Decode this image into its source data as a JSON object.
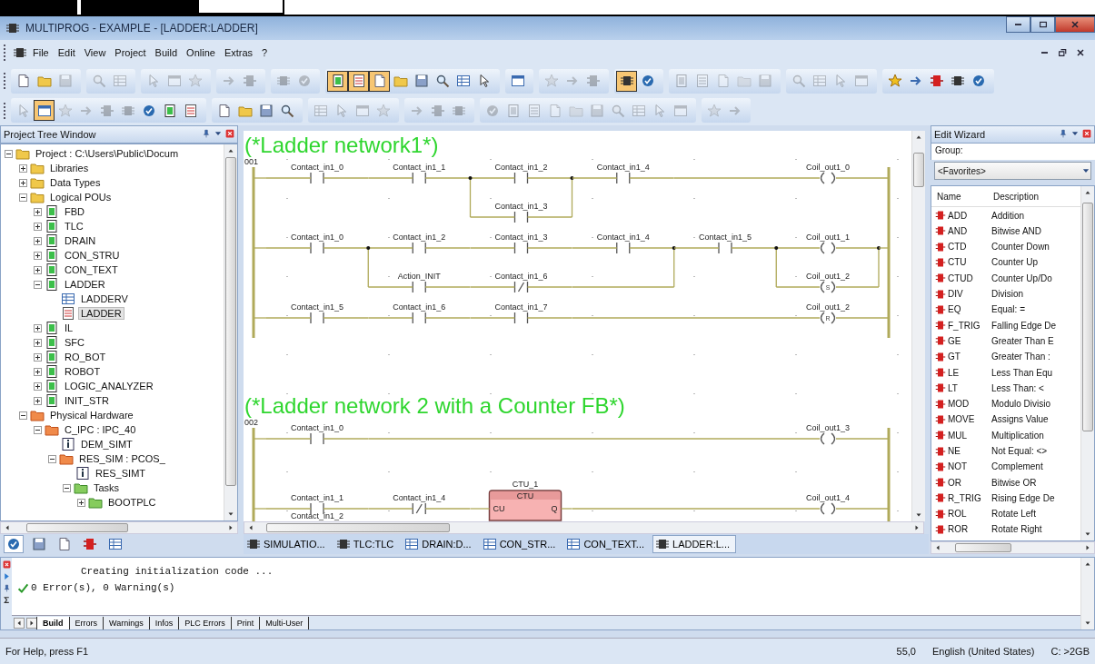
{
  "window": {
    "title": "MULTIPROG - EXAMPLE - [LADDER:LADDER]"
  },
  "menu": [
    "File",
    "Edit",
    "View",
    "Project",
    "Build",
    "Online",
    "Extras",
    "?"
  ],
  "toolbars": [
    [
      [
        {
          "on": false,
          "disabled": false
        },
        {
          "on": false,
          "disabled": false
        },
        {
          "on": false,
          "disabled": true
        }
      ],
      [
        {
          "on": false,
          "disabled": true
        },
        {
          "on": false,
          "disabled": true
        }
      ],
      [
        {
          "on": false,
          "disabled": true
        },
        {
          "on": false,
          "disabled": true
        },
        {
          "on": false,
          "disabled": true
        }
      ],
      [
        {
          "on": false,
          "disabled": true
        },
        {
          "on": false,
          "disabled": true
        }
      ],
      [
        {
          "on": false,
          "disabled": true
        },
        {
          "on": false,
          "disabled": true
        }
      ],
      [
        {
          "on": true,
          "disabled": false
        },
        {
          "on": true,
          "disabled": false
        },
        {
          "on": true,
          "disabled": false
        },
        {
          "on": false,
          "disabled": false
        },
        {
          "on": false,
          "disabled": false
        },
        {
          "on": false,
          "disabled": false
        },
        {
          "on": false,
          "disabled": false
        },
        {
          "on": false,
          "disabled": false
        }
      ],
      [
        {
          "on": false,
          "disabled": false
        }
      ],
      [
        {
          "on": false,
          "disabled": true
        },
        {
          "on": false,
          "disabled": true
        },
        {
          "on": false,
          "disabled": true
        }
      ],
      [
        {
          "on": true,
          "disabled": false
        },
        {
          "on": false,
          "disabled": false
        }
      ],
      [
        {
          "on": false,
          "disabled": true
        },
        {
          "on": false,
          "disabled": true
        },
        {
          "on": false,
          "disabled": true
        },
        {
          "on": false,
          "disabled": true
        },
        {
          "on": false,
          "disabled": true
        }
      ],
      [
        {
          "on": false,
          "disabled": true
        },
        {
          "on": false,
          "disabled": true
        },
        {
          "on": false,
          "disabled": true
        },
        {
          "on": false,
          "disabled": true
        }
      ],
      [
        {
          "on": false,
          "disabled": false
        },
        {
          "on": false,
          "disabled": false
        },
        {
          "on": false,
          "disabled": false
        },
        {
          "on": false,
          "disabled": false
        },
        {
          "on": false,
          "disabled": false
        }
      ]
    ],
    [
      [
        {
          "on": false,
          "disabled": true
        },
        {
          "on": true,
          "disabled": false
        },
        {
          "on": false,
          "disabled": true
        },
        {
          "on": false,
          "disabled": true
        },
        {
          "on": false,
          "disabled": true
        },
        {
          "on": false,
          "disabled": true
        },
        {
          "on": false,
          "disabled": false
        },
        {
          "on": false,
          "disabled": false
        },
        {
          "on": false,
          "disabled": false
        }
      ],
      [
        {
          "on": false,
          "disabled": false
        },
        {
          "on": false,
          "disabled": false
        },
        {
          "on": false,
          "disabled": false
        },
        {
          "on": false,
          "disabled": false
        }
      ],
      [
        {
          "on": false,
          "disabled": true
        },
        {
          "on": false,
          "disabled": true
        },
        {
          "on": false,
          "disabled": true
        },
        {
          "on": false,
          "disabled": true
        }
      ],
      [
        {
          "on": false,
          "disabled": true
        },
        {
          "on": false,
          "disabled": true
        },
        {
          "on": false,
          "disabled": true
        }
      ],
      [
        {
          "on": false,
          "disabled": true
        },
        {
          "on": false,
          "disabled": true
        },
        {
          "on": false,
          "disabled": true
        },
        {
          "on": false,
          "disabled": true
        },
        {
          "on": false,
          "disabled": true
        },
        {
          "on": false,
          "disabled": true
        },
        {
          "on": false,
          "disabled": true
        },
        {
          "on": false,
          "disabled": true
        },
        {
          "on": false,
          "disabled": true
        },
        {
          "on": false,
          "disabled": true
        }
      ],
      [
        {
          "on": false,
          "disabled": true
        },
        {
          "on": false,
          "disabled": true
        }
      ]
    ]
  ],
  "project_tree": {
    "title": "Project Tree Window",
    "items": [
      {
        "label": "Project : C:\\Users\\Public\\Docum",
        "kind": "folder",
        "expanded": true,
        "selected": false,
        "children": [
          {
            "label": "Libraries",
            "kind": "folder",
            "expanded": false,
            "selected": false
          },
          {
            "label": "Data Types",
            "kind": "folder",
            "expanded": false,
            "selected": false
          },
          {
            "label": "Logical POUs",
            "kind": "folder",
            "expanded": true,
            "selected": false,
            "children": [
              {
                "label": "FBD",
                "kind": "pou",
                "expanded": false,
                "selected": false
              },
              {
                "label": "TLC",
                "kind": "pou",
                "expanded": false,
                "selected": false
              },
              {
                "label": "DRAIN",
                "kind": "pou",
                "expanded": false,
                "selected": false
              },
              {
                "label": "CON_STRU",
                "kind": "pou",
                "expanded": false,
                "selected": false
              },
              {
                "label": "CON_TEXT",
                "kind": "pou",
                "expanded": false,
                "selected": false
              },
              {
                "label": "LADDER",
                "kind": "pou",
                "expanded": true,
                "selected": false,
                "children": [
                  {
                    "label": "LADDERV",
                    "kind": "vars",
                    "selected": false
                  },
                  {
                    "label": "LADDER",
                    "kind": "code",
                    "selected": true
                  }
                ]
              },
              {
                "label": "IL",
                "kind": "pou",
                "expanded": false,
                "selected": false
              },
              {
                "label": "SFC",
                "kind": "pou",
                "expanded": false,
                "selected": false
              },
              {
                "label": "RO_BOT",
                "kind": "pou",
                "expanded": false,
                "selected": false
              },
              {
                "label": "ROBOT",
                "kind": "pou",
                "expanded": false,
                "selected": false
              },
              {
                "label": "LOGIC_ANALYZER",
                "kind": "pou",
                "expanded": false,
                "selected": false
              },
              {
                "label": "INIT_STR",
                "kind": "pou",
                "expanded": false,
                "selected": false
              }
            ]
          },
          {
            "label": "Physical Hardware",
            "kind": "hw",
            "expanded": true,
            "selected": false,
            "children": [
              {
                "label": "C_IPC : IPC_40",
                "kind": "hw",
                "expanded": true,
                "selected": false,
                "children": [
                  {
                    "label": "DEM_SIMT",
                    "kind": "info",
                    "selected": false
                  },
                  {
                    "label": "RES_SIM : PCOS_",
                    "kind": "hw",
                    "expanded": true,
                    "selected": false,
                    "children": [
                      {
                        "label": "RES_SIMT",
                        "kind": "info",
                        "selected": false
                      },
                      {
                        "label": "Tasks",
                        "kind": "task",
                        "expanded": true,
                        "selected": false,
                        "children": [
                          {
                            "label": "BOOTPLC",
                            "kind": "task",
                            "expanded": false,
                            "selected": false
                          }
                        ]
                      }
                    ]
                  }
                ]
              }
            ]
          }
        ]
      }
    ],
    "tabs": [
      {
        "selected": true
      },
      {
        "selected": false
      },
      {
        "selected": false
      },
      {
        "selected": false
      },
      {
        "selected": false
      }
    ]
  },
  "editor": {
    "networks": [
      {
        "comment": "(*Ladder network1*)",
        "number": "001",
        "rungs": [
          {
            "items": [
              {
                "kind": "contact",
                "label": "Contact_in1_0"
              },
              {
                "kind": "contact",
                "label": "Contact_in1_1"
              },
              {
                "kind": "parallel",
                "branches": [
                  [
                    {
                      "kind": "contact",
                      "label": "Contact_in1_2"
                    }
                  ],
                  [
                    {
                      "kind": "contact",
                      "label": "Contact_in1_3"
                    }
                  ]
                ]
              },
              {
                "kind": "contact",
                "label": "Contact_in1_4"
              },
              {
                "kind": "coil",
                "label": "Coil_out1_0"
              }
            ]
          },
          {
            "items": [
              {
                "kind": "contact",
                "label": "Contact_in1_0"
              },
              {
                "kind": "parallel",
                "branches": [
                  [
                    {
                      "kind": "contact",
                      "label": "Contact_in1_2"
                    },
                    {
                      "kind": "contact",
                      "label": "Contact_in1_3"
                    },
                    {
                      "kind": "contact",
                      "label": "Contact_in1_4"
                    }
                  ],
                  [
                    {
                      "kind": "contact",
                      "label": "Action_INIT"
                    },
                    {
                      "kind": "contact_negated",
                      "label": "Contact_in1_6"
                    }
                  ]
                ]
              },
              {
                "kind": "contact",
                "label": "Contact_in1_5"
              },
              {
                "kind": "parallel",
                "branches": [
                  [
                    {
                      "kind": "coil",
                      "label": "Coil_out1_1"
                    }
                  ],
                  [
                    {
                      "kind": "coil",
                      "label": "Coil_out1_2",
                      "symbol": "S"
                    }
                  ]
                ]
              }
            ]
          },
          {
            "items": [
              {
                "kind": "contact",
                "label": "Contact_in1_5"
              },
              {
                "kind": "contact",
                "label": "Contact_in1_6"
              },
              {
                "kind": "contact",
                "label": "Contact_in1_7"
              },
              {
                "kind": "coil",
                "label": "Coil_out1_2",
                "symbol": "R"
              }
            ]
          }
        ]
      },
      {
        "comment": "(*Ladder network 2 with a Counter FB*)",
        "number": "002",
        "rungs": [
          {
            "items": [
              {
                "kind": "contact",
                "label": "Contact_in1_0"
              },
              {
                "kind": "coil",
                "label": "Coil_out1_3"
              }
            ]
          },
          {
            "items": [
              {
                "kind": "parallel",
                "branches": [
                  [
                    {
                      "kind": "contact",
                      "label": "Contact_in1_1"
                    }
                  ],
                  [
                    {
                      "kind": "contact",
                      "label": "Contact_in1_2",
                      "clipped": true
                    }
                  ]
                ]
              },
              {
                "kind": "contact_negated",
                "label": "Contact_in1_4"
              },
              {
                "kind": "fb",
                "instance": "CTU_1",
                "type": "CTU",
                "inputs": [
                  "CU"
                ],
                "outputs": [
                  "Q"
                ]
              },
              {
                "kind": "coil",
                "label": "Coil_out1_4"
              }
            ]
          }
        ]
      }
    ],
    "tabs": [
      {
        "label": "SIMULATIO...",
        "kind": "ladder",
        "selected": false
      },
      {
        "label": "TLC:TLC",
        "kind": "ladder",
        "selected": false
      },
      {
        "label": "DRAIN:D...",
        "kind": "table",
        "selected": false
      },
      {
        "label": "CON_STR...",
        "kind": "table",
        "selected": false
      },
      {
        "label": "CON_TEXT...",
        "kind": "table",
        "selected": false
      },
      {
        "label": "LADDER:L...",
        "kind": "ladder",
        "selected": true
      }
    ]
  },
  "edit_wizard": {
    "title": "Edit Wizard",
    "group_label": "Group:",
    "group_value": "<Favorites>",
    "columns": [
      "Name",
      "Description"
    ],
    "rows": [
      {
        "name": "ADD",
        "description": "Addition"
      },
      {
        "name": "AND",
        "description": "Bitwise AND"
      },
      {
        "name": "CTD",
        "description": "Counter Down"
      },
      {
        "name": "CTU",
        "description": "Counter Up"
      },
      {
        "name": "CTUD",
        "description": "Counter Up/Do"
      },
      {
        "name": "DIV",
        "description": "Division"
      },
      {
        "name": "EQ",
        "description": "Equal: ="
      },
      {
        "name": "F_TRIG",
        "description": "Falling Edge De"
      },
      {
        "name": "GE",
        "description": "Greater Than E"
      },
      {
        "name": "GT",
        "description": "Greater Than :"
      },
      {
        "name": "LE",
        "description": "Less Than Equ"
      },
      {
        "name": "LT",
        "description": "Less Than: <"
      },
      {
        "name": "MOD",
        "description": "Modulo Divisio"
      },
      {
        "name": "MOVE",
        "description": "Assigns Value"
      },
      {
        "name": "MUL",
        "description": "Multiplication"
      },
      {
        "name": "NE",
        "description": "Not Equal: <>"
      },
      {
        "name": "NOT",
        "description": "Complement"
      },
      {
        "name": "OR",
        "description": "Bitwise OR"
      },
      {
        "name": "R_TRIG",
        "description": "Rising Edge De"
      },
      {
        "name": "ROL",
        "description": "Rotate Left"
      },
      {
        "name": "ROR",
        "description": "Rotate Right"
      }
    ]
  },
  "output": {
    "lines": [
      {
        "text": "Creating initialization code ...",
        "ok": false
      },
      {
        "text": "0 Error(s), 0 Warning(s)",
        "ok": true
      }
    ],
    "tabs": [
      {
        "label": "Build",
        "selected": true
      },
      {
        "label": "Errors",
        "selected": false
      },
      {
        "label": "Warnings",
        "selected": false
      },
      {
        "label": "Infos",
        "selected": false
      },
      {
        "label": "PLC Errors",
        "selected": false
      },
      {
        "label": "Print",
        "selected": false
      },
      {
        "label": "Multi-User",
        "selected": false
      }
    ]
  },
  "status_bar": [
    "For Help, press F1",
    "55,0",
    "English (United States)",
    "C: >2GB"
  ]
}
